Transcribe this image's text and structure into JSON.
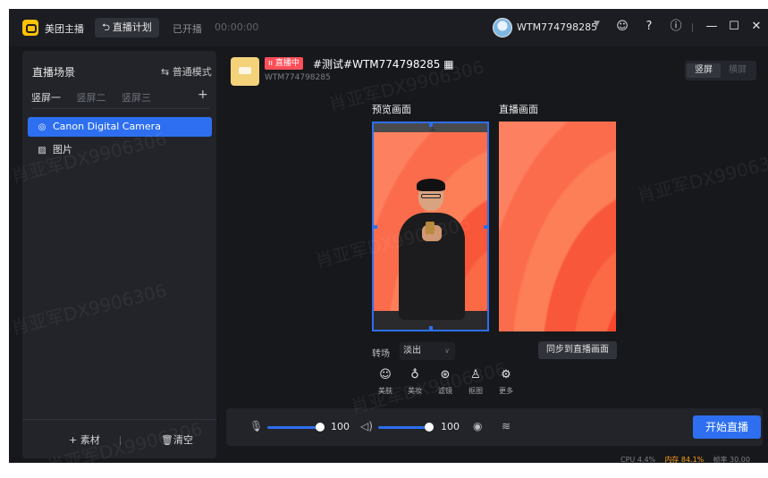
{
  "app": {
    "name": "美团主播",
    "plan_label": "直播计划",
    "status_text": "已开播",
    "timer": "00:00:00"
  },
  "user": {
    "name": "WTM774798285"
  },
  "left_panel": {
    "title": "直播场景",
    "mode_label": "普通模式",
    "scene_tabs": [
      "竖屏一",
      "竖屏二",
      "竖屏三"
    ],
    "sources": [
      {
        "label": "Canon Digital Camera",
        "icon": "camera-icon",
        "selected": true
      },
      {
        "label": "图片",
        "icon": "image-icon",
        "selected": false
      }
    ],
    "footer": {
      "add_label": "素材",
      "clear_label": "清空"
    }
  },
  "header": {
    "live_badge": "直播中",
    "room_title": "#测试#WTM774798285",
    "room_id": "WTM774798285",
    "orientation": {
      "portrait": "竖屏",
      "landscape": "横屏",
      "active": "portrait"
    }
  },
  "preview": {
    "preview_label": "预览画面",
    "live_label": "直播画面"
  },
  "transition": {
    "label": "转场",
    "value": "淡出"
  },
  "sync_label": "同步到直播画面",
  "tools": [
    {
      "label": "美肤",
      "icon": "beauty-skin-icon"
    },
    {
      "label": "美妆",
      "icon": "makeup-icon"
    },
    {
      "label": "滤镜",
      "icon": "filter-icon"
    },
    {
      "label": "抠图",
      "icon": "cutout-icon"
    },
    {
      "label": "更多",
      "icon": "more-settings-icon"
    }
  ],
  "controls": {
    "mic_volume": "100",
    "speaker_volume": "100",
    "start_label": "开始直播"
  },
  "status": {
    "cpu_label": "CPU",
    "cpu_value": "4.4%",
    "mem_label": "内存",
    "mem_value": "84.1%",
    "fps_label": "帧率",
    "fps_value": "30.00"
  },
  "watermarks": [
    "肖亚军DX9906306",
    "肖亚军DX9906306",
    "肖亚军DX9906306",
    "肖亚军DX9906306",
    "肖亚军DX9906306",
    "肖亚军DX9906306",
    "肖亚军DX9906306"
  ],
  "colors": {
    "accent": "#2d6ff0",
    "live_badge": "#ff4f59",
    "background": "#16181c",
    "warning": "#ff9f1a"
  }
}
